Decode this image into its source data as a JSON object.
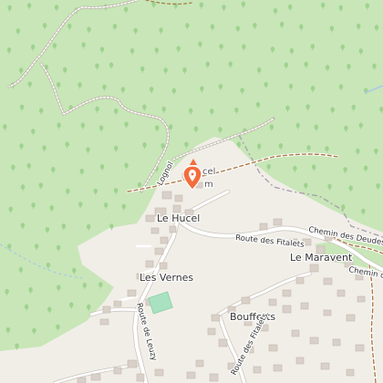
{
  "map": {
    "place_labels": {
      "le_hucel": "Le Hucel",
      "les_vernes": "Les Vernes",
      "le_maravent": "Le Maravent",
      "boufferts": "Boufferts"
    },
    "road_labels": {
      "route_des_fitalets_main": "Route des Fitalets",
      "route_des_fitalets_south": "Route des Fitalets",
      "chemin_des_deudes": "Chemin des Deudes",
      "chemin_de": "Chemin de",
      "route_de_leuzy": "Route de Leuzy",
      "lognol": "Lognol"
    },
    "poi": {
      "partial_text_line1": "cel",
      "partial_text_line2": "m",
      "marker_icon": "map-pin-icon"
    },
    "colors": {
      "forest": "#c8e6b8",
      "land": "#f1eee8",
      "tree_glyph": "#9fd28f",
      "road": "#ffffff",
      "road_casing": "#c8c3bc",
      "building": "#d9d0c9",
      "track": "#a97b47",
      "path_dashed": "#ffffff",
      "marker": "#f26d3d",
      "park": "#a9e2c0",
      "boundary": "#a9a1b2"
    }
  }
}
